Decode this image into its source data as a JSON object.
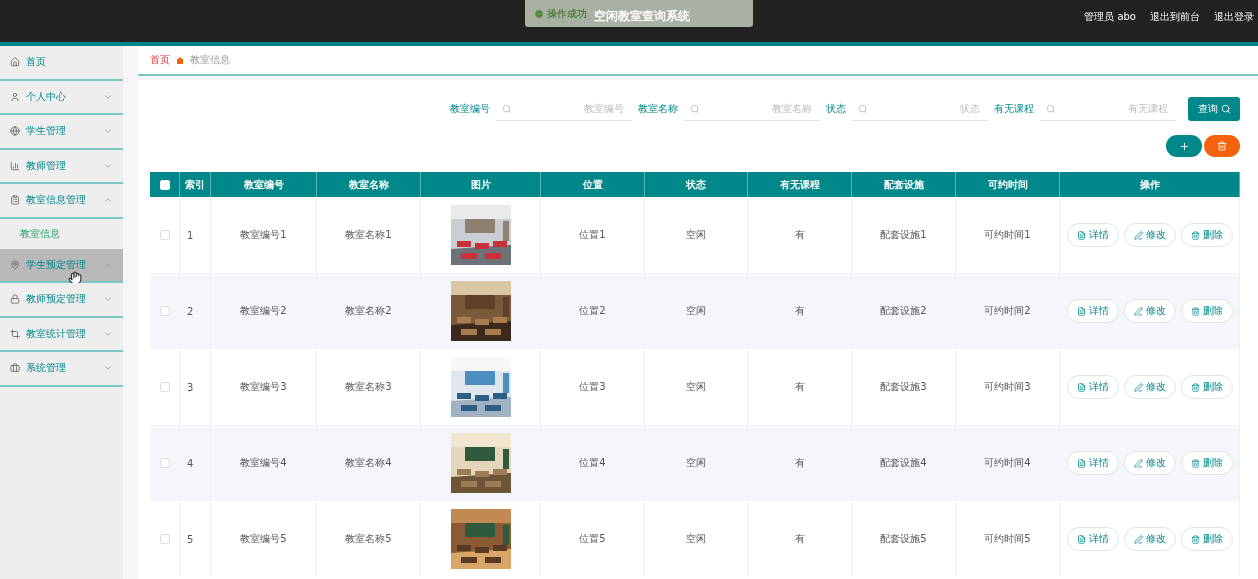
{
  "header": {
    "title": "空闲教室查询系统",
    "user": "管理员 abo",
    "links": [
      "退出到前台",
      "退出登录"
    ]
  },
  "toast": {
    "message": "操作成功"
  },
  "sidebar": {
    "items": [
      {
        "label": "首页",
        "expanded": false,
        "highlighted": false,
        "has_arrow": false
      },
      {
        "label": "个人中心",
        "expanded": false,
        "highlighted": false,
        "has_arrow": true
      },
      {
        "label": "学生管理",
        "expanded": false,
        "highlighted": false,
        "has_arrow": true
      },
      {
        "label": "教师管理",
        "expanded": false,
        "highlighted": false,
        "has_arrow": true
      },
      {
        "label": "教室信息管理",
        "expanded": true,
        "highlighted": false,
        "has_arrow": true,
        "children": [
          {
            "label": "教室信息"
          }
        ]
      },
      {
        "label": "学生预定管理",
        "expanded": false,
        "highlighted": true,
        "has_arrow": true
      },
      {
        "label": "教师预定管理",
        "expanded": false,
        "highlighted": false,
        "has_arrow": true
      },
      {
        "label": "教室统计管理",
        "expanded": false,
        "highlighted": false,
        "has_arrow": true
      },
      {
        "label": "系统管理",
        "expanded": false,
        "highlighted": false,
        "has_arrow": true
      }
    ]
  },
  "breadcrumb": [
    "首页",
    "教室信息"
  ],
  "search": {
    "fields": [
      {
        "label": "教室编号",
        "placeholder": "教室编号"
      },
      {
        "label": "教室名称",
        "placeholder": "教室名称"
      },
      {
        "label": "状态",
        "placeholder": "状态"
      },
      {
        "label": "有无课程",
        "placeholder": "有无课程"
      }
    ],
    "button": "查询"
  },
  "table": {
    "select_all_checked": false,
    "columns": [
      "索引",
      "教室编号",
      "教室名称",
      "图片",
      "位置",
      "状态",
      "有无课程",
      "配套设施",
      "可约时间",
      "操作"
    ],
    "rows": [
      {
        "checked": false,
        "index": "1",
        "code": "教室编号1",
        "name": "教室名称1",
        "picture": {
          "kind": "picture"
        },
        "location": "位置1",
        "status": "空闲",
        "has_course": "有",
        "facilities": "配套设施1",
        "time": "可约时间1",
        "actions": [
          "详情",
          "修改",
          "删除"
        ]
      },
      {
        "checked": false,
        "index": "2",
        "code": "教室编号2",
        "name": "教室名称2",
        "picture": {
          "kind": "picture"
        },
        "location": "位置2",
        "status": "空闲",
        "has_course": "有",
        "facilities": "配套设施2",
        "time": "可约时间2",
        "actions": [
          "详情",
          "修改",
          "删除"
        ]
      },
      {
        "checked": false,
        "index": "3",
        "code": "教室编号3",
        "name": "教室名称3",
        "picture": {
          "kind": "picture"
        },
        "location": "位置3",
        "status": "空闲",
        "has_course": "有",
        "facilities": "配套设施3",
        "time": "可约时间3",
        "actions": [
          "详情",
          "修改",
          "删除"
        ]
      },
      {
        "checked": false,
        "index": "4",
        "code": "教室编号4",
        "name": "教室名称4",
        "picture": {
          "kind": "picture"
        },
        "location": "位置4",
        "status": "空闲",
        "has_course": "有",
        "facilities": "配套设施4",
        "time": "可约时间4",
        "actions": [
          "详情",
          "修改",
          "删除"
        ]
      },
      {
        "checked": false,
        "index": "5",
        "code": "教室编号5",
        "name": "教室名称5",
        "picture": {
          "kind": "picture"
        },
        "location": "位置5",
        "status": "空闲",
        "has_course": "有",
        "facilities": "配套设施5",
        "time": "可约时间5",
        "actions": [
          "详情",
          "修改",
          "删除"
        ]
      }
    ]
  }
}
